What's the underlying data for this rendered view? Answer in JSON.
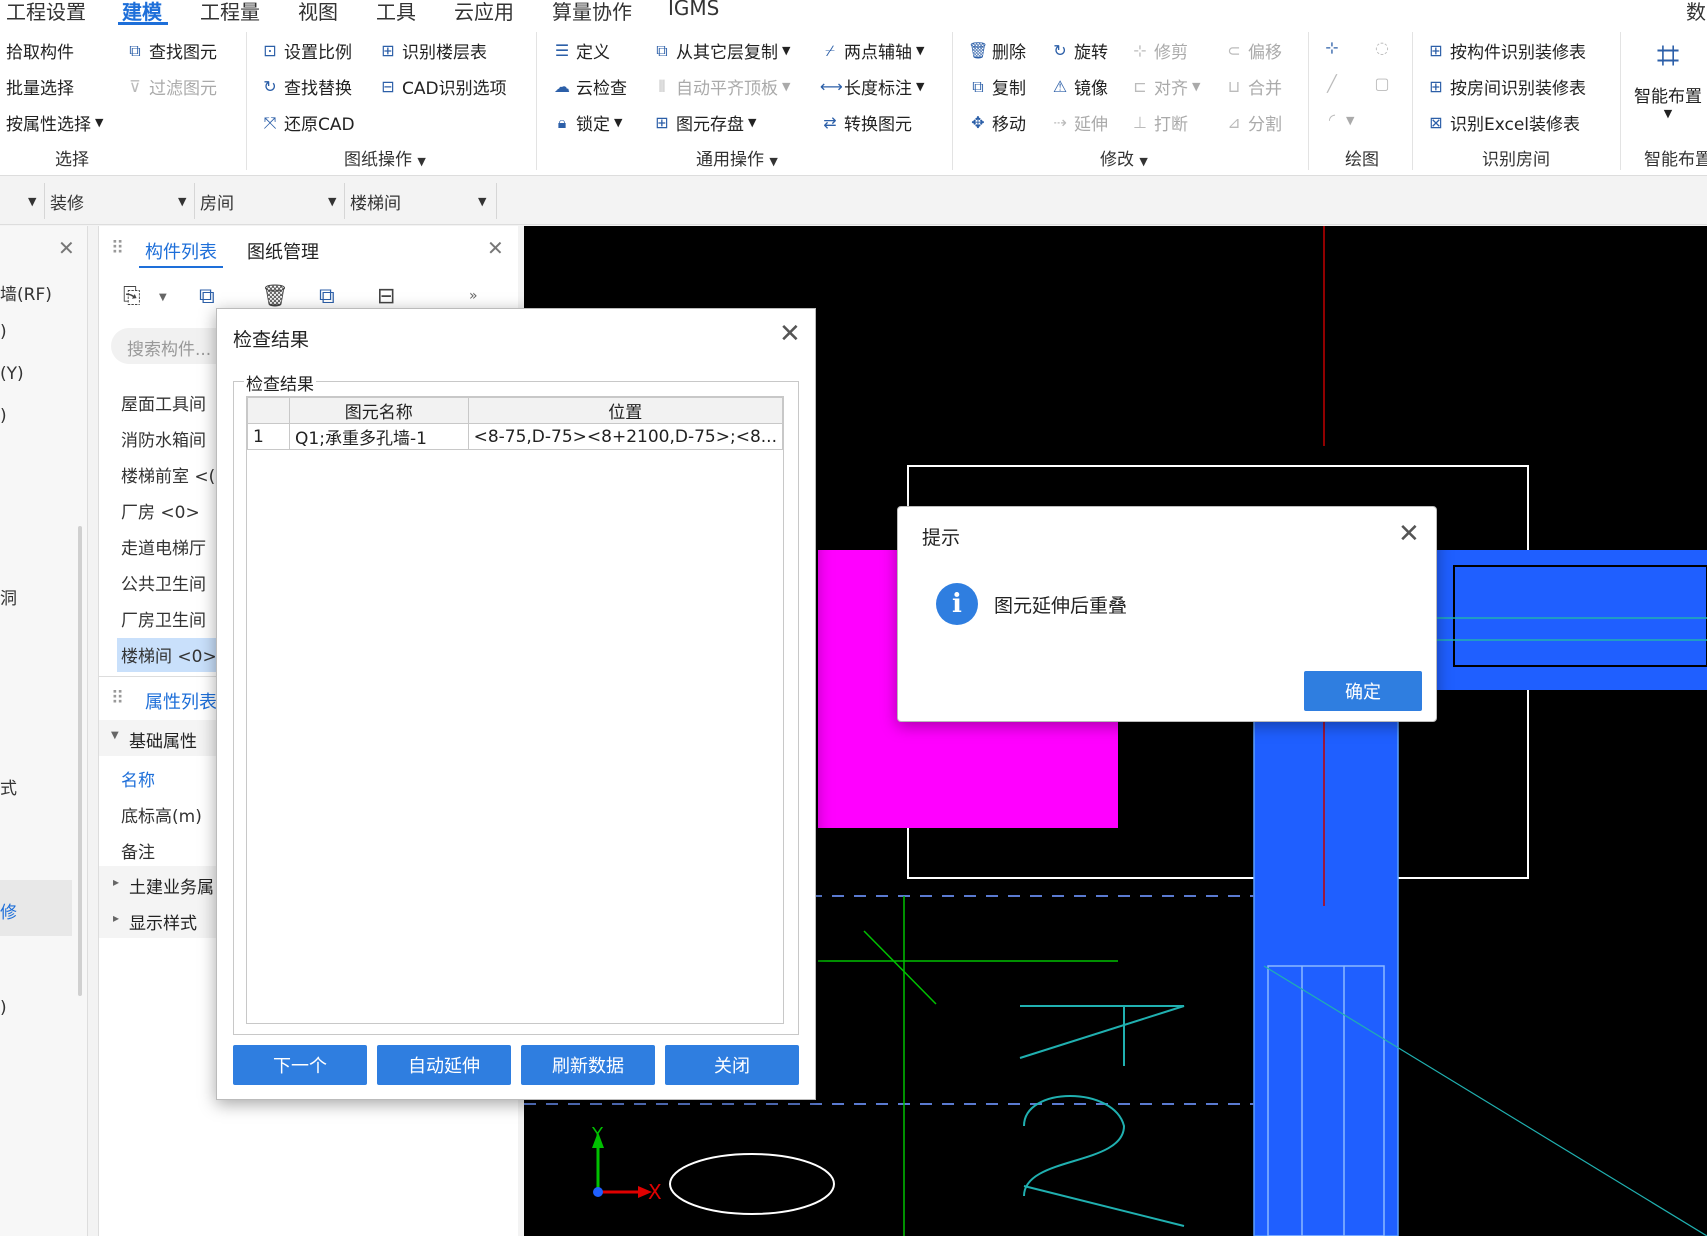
{
  "menu": {
    "items": [
      "工程设置",
      "建模",
      "工程量",
      "视图",
      "工具",
      "云应用",
      "算量协作",
      "IGMS"
    ],
    "right_text": "数"
  },
  "ribbon": {
    "select": {
      "pick": "拾取构件",
      "batch": "批量选择",
      "by_attr": "按属性选择",
      "find": "查找图元",
      "filter": "过滤图元",
      "label": "选择"
    },
    "drawing": {
      "scale": "设置比例",
      "floor_table": "识别楼层表",
      "find_replace": "查找替换",
      "cad_options": "CAD识别选项",
      "restore": "还原CAD",
      "label": "图纸操作"
    },
    "common": {
      "define": "定义",
      "copy_layer": "从其它层复制",
      "two_point": "两点辅轴",
      "cloud_check": "云检查",
      "auto_flush": "自动平齐顶板",
      "length_dim": "长度标注",
      "lock": "锁定",
      "save_elem": "图元存盘",
      "convert": "转换图元",
      "label": "通用操作"
    },
    "modify": {
      "delete": "删除",
      "rotate": "旋转",
      "trim": "修剪",
      "offset": "偏移",
      "copy": "复制",
      "mirror": "镜像",
      "align": "对齐",
      "merge": "合并",
      "move": "移动",
      "extend": "延伸",
      "break": "打断",
      "split": "分割",
      "label": "修改"
    },
    "draw": {
      "label": "绘图"
    },
    "room": {
      "by_component": "按构件识别装修表",
      "by_room": "按房间识别装修表",
      "by_excel": "识别Excel装修表",
      "label": "识别房间"
    },
    "smart": {
      "button": "智能布置",
      "label": "智能布置"
    }
  },
  "filters": [
    "装修",
    "房间",
    "楼梯间"
  ],
  "left_panel": {
    "items": [
      "墙(RF)",
      ")",
      "(Y)",
      ")",
      "洞",
      "式",
      "",
      "修",
      ")"
    ]
  },
  "component_panel": {
    "tabs": [
      "构件列表",
      "图纸管理"
    ],
    "search_placeholder": "搜索构件...",
    "items": [
      "屋面工具间",
      "消防水箱间",
      "楼梯前室 <(",
      "厂房 <0>",
      "走道电梯厅",
      "公共卫生间",
      "厂房卫生间",
      "楼梯间 <0>"
    ],
    "selected_index": 7
  },
  "property_panel": {
    "title": "属性列表",
    "section": "基础属性",
    "rows": [
      "名称",
      "底标高(m)",
      "备注"
    ],
    "collapsed": [
      "土建业务属",
      "显示样式"
    ]
  },
  "check_dialog": {
    "title": "检查结果",
    "group_label": "检查结果",
    "headers": [
      "图元名称",
      "位置"
    ],
    "rows": [
      {
        "index": "1",
        "name": "Q1;承重多孔墙-1",
        "position": "<8-75,D-75><8+2100,D-75>;<8..."
      }
    ],
    "buttons": {
      "next": "下一个",
      "auto_extend": "自动延伸",
      "refresh": "刷新数据",
      "close": "关闭"
    }
  },
  "tip_dialog": {
    "title": "提示",
    "message": "图元延伸后重叠",
    "ok": "确定"
  },
  "canvas": {
    "axis_x": "X",
    "axis_y": "Y",
    "colors": {
      "magenta": "#ff00ff",
      "blue": "#1f5fff",
      "cyan": "#20b0b0",
      "green": "#00c000"
    }
  }
}
